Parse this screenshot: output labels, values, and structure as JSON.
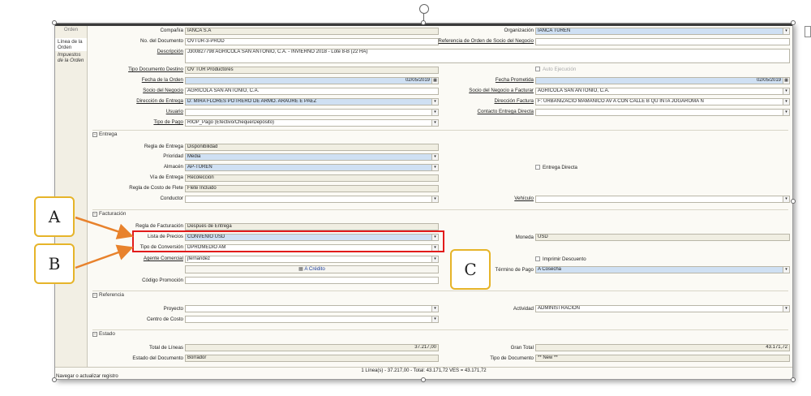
{
  "left_panel": {
    "header": "Orden",
    "tabs": [
      "Línea de la Orden",
      "Impuestos de la Orden"
    ]
  },
  "header_fields": {
    "compania": {
      "label": "Compañía",
      "value": "IANCA S.A"
    },
    "organizacion": {
      "label": "Organización",
      "value": "IANCA TUREN"
    },
    "no_documento": {
      "label": "No. del Documento",
      "value": "OVTUR-3-PROD"
    },
    "ref_orden": {
      "label": "Referencia de Orden de Socio del Negocio",
      "value": ""
    },
    "descripcion": {
      "label": "Descripción",
      "value": "J300827798 AGRICOLA SAN ANTONIO, C.A. - INVIERNO 2018 - Lote 8-B (22 HA)"
    },
    "tipo_doc": {
      "label": "Tipo Documento Destino",
      "value": "OV TUR Productores"
    },
    "auto_ejecucion": {
      "label": "Auto Ejecución"
    },
    "fecha_orden": {
      "label": "Fecha de la Orden",
      "value": "02/05/2019"
    },
    "fecha_prometida": {
      "label": "Fecha Prometida",
      "value": "02/05/2019"
    },
    "socio": {
      "label": "Socio del Negocio",
      "value": "AGRICOLA SAN ANTONIO, C.A."
    },
    "socio_facturar": {
      "label": "Socio del Negocio a Facturar",
      "value": "AGRICOLA SAN ANTONIO, C.A."
    },
    "dir_entrega": {
      "label": "Dirección de Entrega",
      "value": "D: MIRA FLORES POTRERO DE ARMO. ARAURE  E PAEZ"
    },
    "dir_factura": {
      "label": "Dirección Factura",
      "value": "F: URBANIZACIO MAMANICO AV A CON CALLE B QU INTA JOGAROMA N"
    },
    "usuario": {
      "label": "Usuario",
      "value": ""
    },
    "contacto": {
      "label": "Contacto Entrega Directa",
      "value": ""
    },
    "tipo_pago": {
      "label": "Tipo de Pago",
      "value": "RIOP_Pago (Efectivo/Cheque/Depósito)"
    }
  },
  "entrega": {
    "title": "Entrega",
    "regla": {
      "label": "Regla de Entrega",
      "value": "Disponibilidad"
    },
    "prioridad": {
      "label": "Prioridad",
      "value": "Media"
    },
    "almacen": {
      "label": "Almacén",
      "value": "AP-TUREN"
    },
    "entrega_directa": {
      "label": "Entrega Directa"
    },
    "via": {
      "label": "Vía de Entrega",
      "value": "Recolección"
    },
    "regla_flete": {
      "label": "Regla de Costo de Flete",
      "value": "Flete Incluido"
    },
    "conductor": {
      "label": "Conductor",
      "value": ""
    },
    "vehiculo": {
      "label": "Vehículo",
      "value": ""
    }
  },
  "facturacion": {
    "title": "Facturación",
    "regla": {
      "label": "Regla de Facturación",
      "value": "Después de Entrega"
    },
    "lista_precios": {
      "label": "Lista de Precios",
      "value": "CONVENIO USD"
    },
    "moneda": {
      "label": "Moneda",
      "value": "USD"
    },
    "tipo_conversion": {
      "label": "Tipo de Conversión",
      "value": "DPROMEDIO AM"
    },
    "agente": {
      "label": "Agente Comercial",
      "value": "jfernandez"
    },
    "imprimir_descuento": {
      "label": "Imprimir Descuento"
    },
    "credito_button": "A Crédito",
    "termino_pago": {
      "label": "Término de Pago",
      "value": "A Cosecha"
    },
    "codigo_promo": {
      "label": "Código Promoción",
      "value": ""
    }
  },
  "referencia": {
    "title": "Referencia",
    "proyecto": {
      "label": "Proyecto",
      "value": ""
    },
    "actividad": {
      "label": "Actividad",
      "value": "ADMINISTRACION"
    },
    "centro_costo": {
      "label": "Centro de Costo",
      "value": ""
    }
  },
  "estado": {
    "title": "Estado",
    "total_lineas": {
      "label": "Total de Líneas",
      "value": "37.217,00"
    },
    "gran_total": {
      "label": "Gran Total",
      "value": "43.171,72"
    },
    "estado_doc": {
      "label": "Estado del Documento",
      "value": "Borrador"
    },
    "tipo_doc": {
      "label": "Tipo de Documento",
      "value": "** New **"
    }
  },
  "status": {
    "summary": "1 Línea(s) - 37.217,00 -  Total: 43.171,72  VES =  43.171,72",
    "message": "Navegar o actualizar registro"
  },
  "callouts": {
    "a": "A",
    "b": "B",
    "c": "C"
  },
  "colors": {
    "highlight_box": "#e21b1b",
    "callout_border": "#e6b429",
    "arrow": "#e8822c",
    "field_blue": "#cfe0f3"
  }
}
